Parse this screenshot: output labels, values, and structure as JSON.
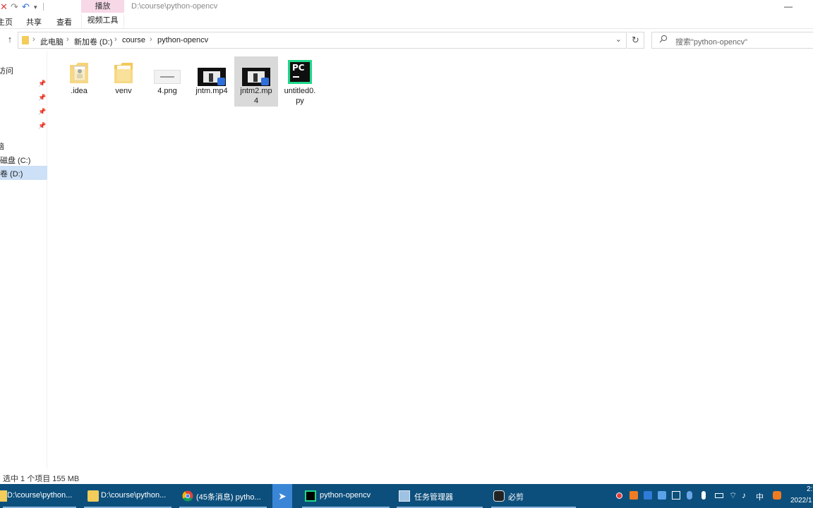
{
  "window": {
    "path_title": "D:\\course\\python-opencv",
    "context_tab_head": "播放",
    "minimize": "—"
  },
  "quick_access": {
    "close_glyph": "✕",
    "redo_glyph": "↷",
    "undo_glyph": "↶",
    "dropdown_glyph": "▾"
  },
  "ribbon": {
    "tabs": [
      "主页",
      "共享",
      "查看"
    ],
    "context_tab": "视频工具"
  },
  "address": {
    "up_glyph": "↑",
    "breadcrumbs": [
      "此电脑",
      "新加卷 (D:)",
      "course",
      "python-opencv"
    ],
    "separator": "›",
    "dropdown_glyph": "⌄",
    "refresh_glyph": "↻"
  },
  "search": {
    "icon": "search-icon",
    "placeholder": "搜索\"python-opencv\""
  },
  "nav": {
    "quick_access_label": "访问",
    "pin_glyph": "📌",
    "this_pc": "脑",
    "drive_c": "磁盘 (C:)",
    "drive_d": "卷 (D:)"
  },
  "files": [
    {
      "name": ".idea",
      "kind": "folder-doc"
    },
    {
      "name": "venv",
      "kind": "folder"
    },
    {
      "name": "4.png",
      "kind": "image"
    },
    {
      "name": "jntm.mp4",
      "kind": "video"
    },
    {
      "name": "jntm2.mp4",
      "kind": "video",
      "selected": true
    },
    {
      "name": "untitled0.py",
      "kind": "pycharm"
    }
  ],
  "status": {
    "text": "选中 1 个项目  155 MB"
  },
  "taskbar": {
    "items": [
      {
        "label": "D:\\course\\python...",
        "icon": "edge-icon"
      },
      {
        "label": "D:\\course\\python...",
        "icon": "folder-icon"
      },
      {
        "label": "(45条消息) pytho...",
        "icon": "chrome-icon"
      },
      {
        "label": "",
        "icon": "bird-icon"
      },
      {
        "label": "python-opencv",
        "icon": "pycharm-icon"
      },
      {
        "label": "任务管理器",
        "icon": "task-manager-icon"
      },
      {
        "label": "必剪",
        "icon": "bijian-icon"
      }
    ],
    "tray": {
      "ime": "中",
      "time": "2:",
      "date": "2022/1"
    },
    "colors": {
      "bar": "#0c4f7c",
      "record_dot": "#e53b3b",
      "orange": "#f07c22",
      "blue": "#2f7bd8"
    }
  }
}
